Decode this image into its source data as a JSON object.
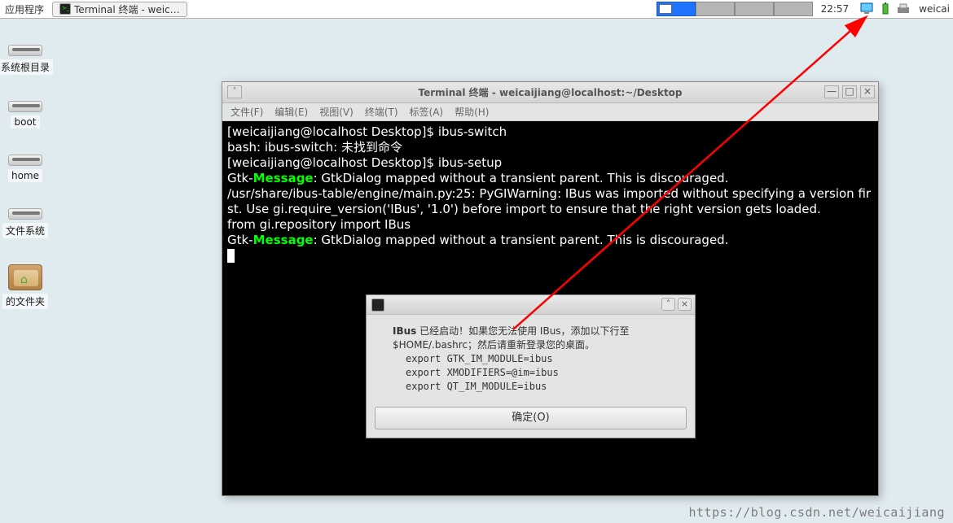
{
  "panel": {
    "apps_label": "应用程序",
    "task_label": "Terminal 终端 - weic…",
    "clock": "22:57",
    "user": "weicai"
  },
  "desktop_icons": {
    "root": "系统根目录",
    "boot": "boot",
    "home": "home",
    "fs": "文件系统",
    "folder": "的文件夹"
  },
  "terminal": {
    "title": "Terminal 终端 - weicaijiang@localhost:~/Desktop",
    "menu": {
      "file": "文件(F)",
      "edit": "编辑(E)",
      "view": "视图(V)",
      "terminal": "终端(T)",
      "tabs": "标签(A)",
      "help": "帮助(H)"
    },
    "lines": {
      "prompt1_a": "[weicaijiang@localhost Desktop]$ ",
      "cmd1": "ibus-switch",
      "err": "bash: ibus-switch: 未找到命令",
      "prompt2_a": "[weicaijiang@localhost Desktop]$ ",
      "cmd2": "ibus-setup",
      "gtk1a": "Gtk-",
      "msg": "Message",
      "gtk1b": ": GtkDialog mapped without a transient parent. This is discouraged.",
      "warn1": "/usr/share/ibus-table/engine/main.py:25: PyGIWarning: IBus was imported without specifying a version first. Use gi.require_version('IBus', '1.0') before import to ensure that the right version gets loaded.",
      "warn2": "  from gi.repository import IBus",
      "gtk2a": "Gtk-",
      "gtk2b": ": GtkDialog mapped without a transient parent. This is discouraged."
    }
  },
  "ibus_dialog": {
    "line1a": "IBus",
    "line1b": "  已经启动！如果您无法使用 IBus，添加以下行至 $HOME/.bashrc；然后请重新登录您的桌面。",
    "export1": "export GTK_IM_MODULE=ibus",
    "export2": "export XMODIFIERS=@im=ibus",
    "export3": "export QT_IM_MODULE=ibus",
    "ok": "确定(O)"
  },
  "watermark": "https://blog.csdn.net/weicaijiang"
}
